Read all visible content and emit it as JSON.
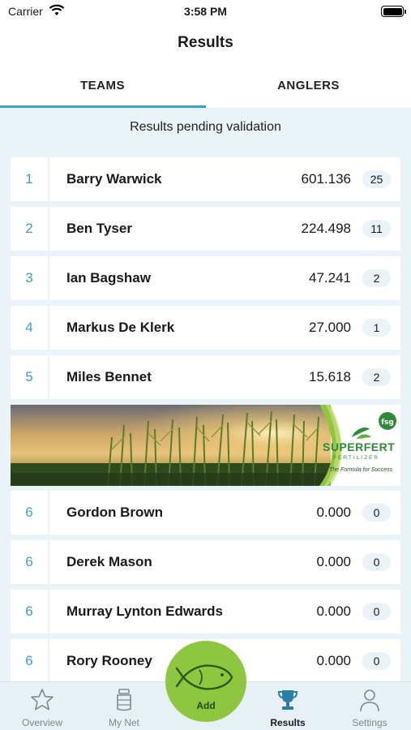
{
  "status_bar": {
    "carrier": "Carrier",
    "time": "3:58 PM"
  },
  "header": {
    "title": "Results"
  },
  "tabs": [
    {
      "label": "TEAMS",
      "selected": true
    },
    {
      "label": "ANGLERS",
      "selected": false
    }
  ],
  "pending_message": "Results pending validation",
  "results": [
    {
      "rank": "1",
      "name": "Barry Warwick",
      "score": "601.136",
      "count": "25"
    },
    {
      "rank": "2",
      "name": "Ben Tyser",
      "score": "224.498",
      "count": "11"
    },
    {
      "rank": "3",
      "name": "Ian Bagshaw",
      "score": "47.241",
      "count": "2"
    },
    {
      "rank": "4",
      "name": "Markus De Klerk",
      "score": "27.000",
      "count": "1"
    },
    {
      "rank": "5",
      "name": "Miles Bennet",
      "score": "15.618",
      "count": "2"
    },
    {
      "rank": "6",
      "name": "Gordon Brown",
      "score": "0.000",
      "count": "0"
    },
    {
      "rank": "6",
      "name": "Derek Mason",
      "score": "0.000",
      "count": "0"
    },
    {
      "rank": "6",
      "name": "Murray Lynton Edwards",
      "score": "0.000",
      "count": "0"
    },
    {
      "rank": "6",
      "name": "Rory Rooney",
      "score": "0.000",
      "count": "0"
    }
  ],
  "ad": {
    "brand_a": "SUPER",
    "brand_b": "FERT",
    "subtitle": "FERTILIZER",
    "tagline": "The Formula for Success",
    "logo_text": "fsg"
  },
  "tab_bar": {
    "items": [
      {
        "label": "Overview",
        "icon": "star-icon",
        "active": false
      },
      {
        "label": "My Net",
        "icon": "keepnet-icon",
        "active": false
      },
      {
        "label": "Results",
        "icon": "trophy-icon",
        "active": true
      },
      {
        "label": "Settings",
        "icon": "person-icon",
        "active": false
      }
    ],
    "add_label": "Add"
  },
  "colors": {
    "accent": "#3c9fc9",
    "background": "#e9f3f8",
    "add_button": "#8ec63f",
    "brand_green": "#2d8b3a"
  }
}
